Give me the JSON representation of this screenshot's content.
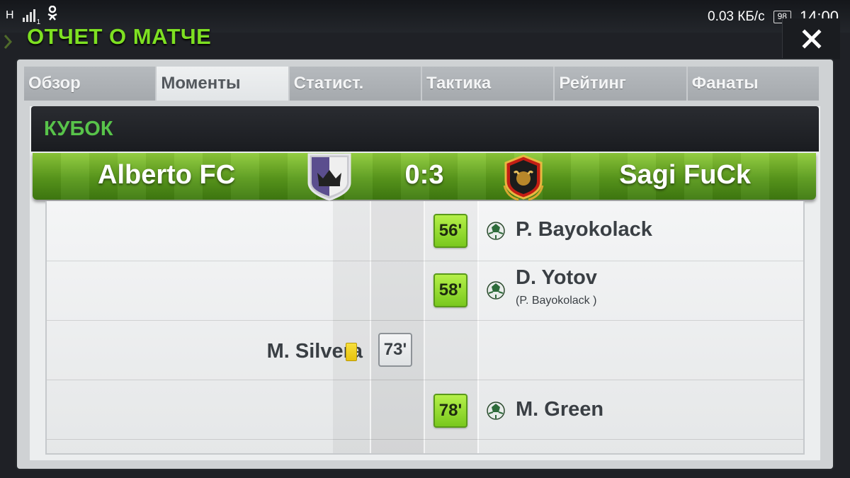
{
  "status_bar": {
    "network_type": "H",
    "sim_indicator": "1",
    "app_icon": "odnoklassniki-icon",
    "speed": "0.03 КБ/с",
    "battery": "98",
    "time": "14:00"
  },
  "header": {
    "title": "ОТЧЕТ О МАТЧЕ",
    "close_icon": "close-icon"
  },
  "tabs": [
    {
      "label": "Обзор",
      "active": false
    },
    {
      "label": "Моменты",
      "active": true
    },
    {
      "label": "Статист.",
      "active": false
    },
    {
      "label": "Тактика",
      "active": false
    },
    {
      "label": "Рейтинг",
      "active": false
    },
    {
      "label": "Фанаты",
      "active": false
    }
  ],
  "competition": "КУБОК",
  "match": {
    "home_team": "Alberto FC",
    "away_team": "Sagi FuCk",
    "score": "0:3"
  },
  "events": [
    {
      "side": "away",
      "type": "goal",
      "minute": "56'",
      "player": "P. Bayokolack",
      "assist": ""
    },
    {
      "side": "away",
      "type": "goal",
      "minute": "58'",
      "player": "D. Yotov",
      "assist": "(P. Bayokolack )"
    },
    {
      "side": "home",
      "type": "yellow-card",
      "minute": "73'",
      "player": "M. Silvera",
      "assist": ""
    },
    {
      "side": "away",
      "type": "goal",
      "minute": "78'",
      "player": "M. Green",
      "assist": ""
    }
  ],
  "colors": {
    "title_green": "#7ee022",
    "section_green": "#58c34a",
    "goal_badge": "#8fd835",
    "yellow_card": "#f1d22a"
  }
}
